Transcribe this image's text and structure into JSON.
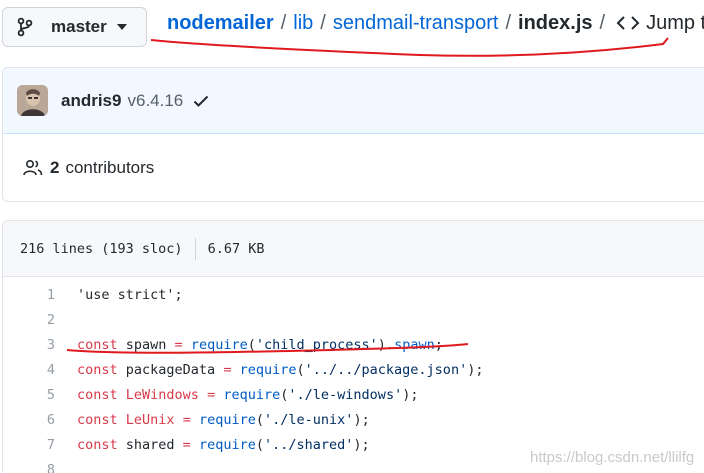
{
  "branch": {
    "name": "master"
  },
  "breadcrumb": {
    "repo": "nodemailer",
    "sep1": "/",
    "dir1": "lib",
    "sep2": "/",
    "dir2": "sendmail-transport",
    "sep3": "/",
    "file": "index.js",
    "sep4": "/",
    "jump_label": "Jump to"
  },
  "commit": {
    "author": "andris9",
    "version": "v6.4.16",
    "status_icon": "check-icon"
  },
  "contributors": {
    "count": "2",
    "label": "contributors"
  },
  "file_info": {
    "lines": "216 lines (193 sloc)",
    "size": "6.67 KB"
  },
  "code": {
    "lines": [
      {
        "num": "1",
        "tokens": [
          {
            "t": "'use strict';",
            "c": "plain"
          }
        ]
      },
      {
        "num": "2",
        "tokens": []
      },
      {
        "num": "3",
        "tokens": [
          {
            "t": "const",
            "c": "keyword"
          },
          {
            "t": " spawn ",
            "c": "plain"
          },
          {
            "t": "=",
            "c": "keyword"
          },
          {
            "t": " ",
            "c": "plain"
          },
          {
            "t": "require",
            "c": "func"
          },
          {
            "t": "(",
            "c": "plain"
          },
          {
            "t": "'child_process'",
            "c": "string"
          },
          {
            "t": ").",
            "c": "plain"
          },
          {
            "t": "spawn",
            "c": "func"
          },
          {
            "t": ";",
            "c": "plain"
          }
        ]
      },
      {
        "num": "4",
        "tokens": [
          {
            "t": "const",
            "c": "keyword"
          },
          {
            "t": " packageData ",
            "c": "plain"
          },
          {
            "t": "=",
            "c": "keyword"
          },
          {
            "t": " ",
            "c": "plain"
          },
          {
            "t": "require",
            "c": "func"
          },
          {
            "t": "(",
            "c": "plain"
          },
          {
            "t": "'../../package.json'",
            "c": "string"
          },
          {
            "t": ");",
            "c": "plain"
          }
        ]
      },
      {
        "num": "5",
        "tokens": [
          {
            "t": "const",
            "c": "keyword"
          },
          {
            "t": " ",
            "c": "plain"
          },
          {
            "t": "LeWindows",
            "c": "keyword"
          },
          {
            "t": " ",
            "c": "plain"
          },
          {
            "t": "=",
            "c": "keyword"
          },
          {
            "t": " ",
            "c": "plain"
          },
          {
            "t": "require",
            "c": "func"
          },
          {
            "t": "(",
            "c": "plain"
          },
          {
            "t": "'./le-windows'",
            "c": "string"
          },
          {
            "t": ");",
            "c": "plain"
          }
        ]
      },
      {
        "num": "6",
        "tokens": [
          {
            "t": "const",
            "c": "keyword"
          },
          {
            "t": " ",
            "c": "plain"
          },
          {
            "t": "LeUnix",
            "c": "keyword"
          },
          {
            "t": " ",
            "c": "plain"
          },
          {
            "t": "=",
            "c": "keyword"
          },
          {
            "t": " ",
            "c": "plain"
          },
          {
            "t": "require",
            "c": "func"
          },
          {
            "t": "(",
            "c": "plain"
          },
          {
            "t": "'./le-unix'",
            "c": "string"
          },
          {
            "t": ");",
            "c": "plain"
          }
        ]
      },
      {
        "num": "7",
        "tokens": [
          {
            "t": "const",
            "c": "keyword"
          },
          {
            "t": " shared ",
            "c": "plain"
          },
          {
            "t": "=",
            "c": "keyword"
          },
          {
            "t": " ",
            "c": "plain"
          },
          {
            "t": "require",
            "c": "func"
          },
          {
            "t": "(",
            "c": "plain"
          },
          {
            "t": "'../shared'",
            "c": "string"
          },
          {
            "t": ");",
            "c": "plain"
          }
        ]
      },
      {
        "num": "8",
        "tokens": []
      }
    ]
  },
  "watermark": {
    "text": "https://blog.csdn.net/llilfg"
  },
  "colors": {
    "link": "#0366d6",
    "keyword": "#d73a49",
    "function": "#005cc5",
    "string": "#032f62",
    "annotation": "#e0191f"
  }
}
